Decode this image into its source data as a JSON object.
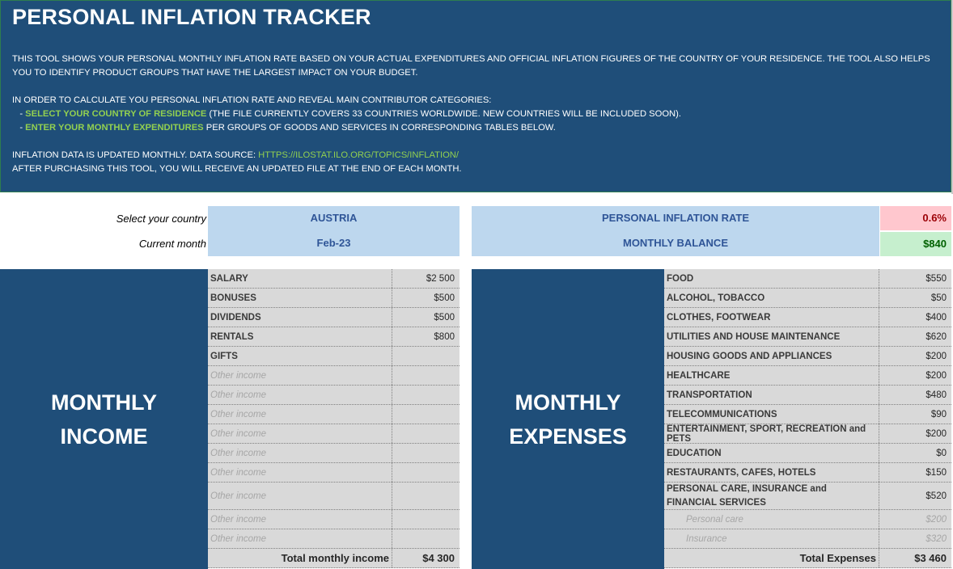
{
  "header": {
    "title": "PERSONAL INFLATION TRACKER",
    "line1": "THIS TOOL SHOWS YOUR PERSONAL MONTHLY INFLATION RATE BASED ON YOUR ACTUAL EXPENDITURES AND OFFICIAL INFLATION FIGURES OF THE COUNTRY OF YOUR RESIDENCE. THE TOOL ALSO HELPS YOU TO IDENTIFY PRODUCT GROUPS THAT HAVE THE LARGEST IMPACT ON YOUR BUDGET.",
    "line2": "IN ORDER TO CALCULATE YOU PERSONAL INFLATION RATE AND REVEAL MAIN CONTRIBUTOR CATEGORIES:",
    "bullet1_prefix": "   - ",
    "bullet1_highlight": "SELECT YOUR COUNTRY OF RESIDENCE",
    "bullet1_rest": " (THE FILE CURRENTLY COVERS 33 COUNTRIES WORLDWIDE. NEW COUNTRIES WILL BE INCLUDED SOON).",
    "bullet2_prefix": "   - ",
    "bullet2_highlight": "ENTER YOUR MONTHLY EXPENDITURES",
    "bullet2_rest": " PER GROUPS OF GOODS AND SERVICES IN CORRESPONDING TABLES BELOW.",
    "source_prefix": "INFLATION DATA IS UPDATED MONTHLY. DATA SOURCE: ",
    "source_link": "HTTPS://ILOSTAT.ILO.ORG/TOPICS/INFLATION/",
    "line_last": "AFTER PURCHASING THIS TOOL, YOU WILL RECEIVE AN UPDATED FILE AT THE END OF EACH MONTH."
  },
  "selection": {
    "country_label": "Select your country",
    "country_value": "AUSTRIA",
    "month_label": "Current month",
    "month_value": "Feb-23"
  },
  "stats": {
    "inflation_label": "PERSONAL INFLATION RATE",
    "inflation_value": "0.6%",
    "balance_label": "MONTHLY BALANCE",
    "balance_value": "$840"
  },
  "income": {
    "block_line1": "MONTHLY",
    "block_line2": "INCOME",
    "rows": [
      {
        "label": "SALARY",
        "value": "$2 500"
      },
      {
        "label": "BONUSES",
        "value": "$500"
      },
      {
        "label": "DIVIDENDS",
        "value": "$500"
      },
      {
        "label": "RENTALS",
        "value": "$800"
      },
      {
        "label": "GIFTS",
        "value": ""
      },
      {
        "label": "Other income",
        "value": ""
      },
      {
        "label": "Other income",
        "value": ""
      },
      {
        "label": "Other income",
        "value": ""
      },
      {
        "label": "Other income",
        "value": ""
      },
      {
        "label": "Other income",
        "value": ""
      },
      {
        "label": "Other income",
        "value": ""
      },
      {
        "label": "Other income",
        "value": ""
      },
      {
        "label": "Other income",
        "value": ""
      },
      {
        "label": "Other income",
        "value": ""
      }
    ],
    "total_label": "Total monthly income",
    "total_value": "$4 300"
  },
  "expenses": {
    "block_line1": "MONTHLY",
    "block_line2": "EXPENSES",
    "rows": [
      {
        "label": "FOOD",
        "value": "$550"
      },
      {
        "label": "ALCOHOL, TOBACCO",
        "value": "$50"
      },
      {
        "label": "CLOTHES, FOOTWEAR",
        "value": "$400"
      },
      {
        "label": "UTILITIES AND HOUSE MAINTENANCE",
        "value": "$620"
      },
      {
        "label": "HOUSING GOODS AND APPLIANCES",
        "value": "$200"
      },
      {
        "label": "HEALTHCARE",
        "value": "$200"
      },
      {
        "label": "TRANSPORTATION",
        "value": "$480"
      },
      {
        "label": "TELECOMMUNICATIONS",
        "value": "$90"
      },
      {
        "label": "ENTERTAINMENT, SPORT, RECREATION and PETS",
        "value": "$200"
      },
      {
        "label": "EDUCATION",
        "value": "$0"
      },
      {
        "label": "RESTAURANTS, CAFES, HOTELS",
        "value": "$150"
      },
      {
        "label": "PERSONAL CARE, INSURANCE and FINANCIAL SERVICES",
        "value": "$520"
      },
      {
        "label": "Personal care",
        "value": "$200"
      },
      {
        "label": "Insurance",
        "value": "$320"
      }
    ],
    "total_label": "Total Expenses",
    "total_value": "$3 460"
  },
  "colors": {
    "header_bg": "#1f4e79",
    "accent_green": "#92d050",
    "input_blue": "#bdd7ee",
    "negative_red": "#9c0006",
    "positive_green": "#006100"
  }
}
